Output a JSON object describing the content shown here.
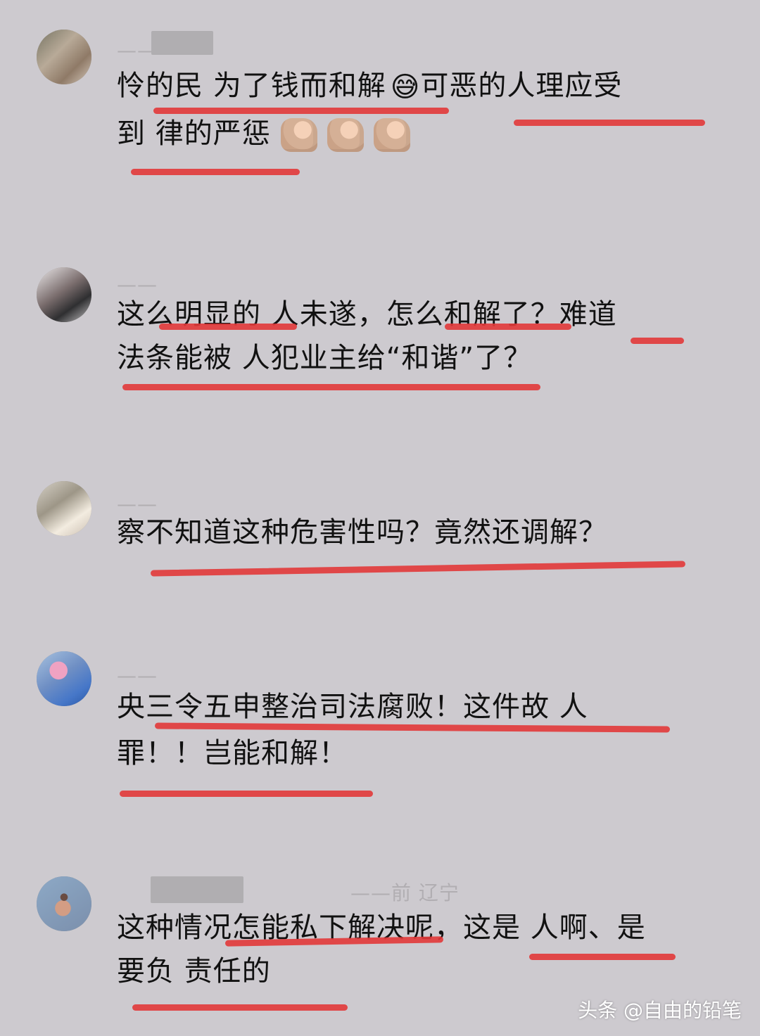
{
  "comments": [
    {
      "id": "c1",
      "meta": "——",
      "lines": [
        "怜的民  为了钱而和解",
        "可恶的人理应受",
        "到 律的严惩"
      ],
      "emoji": "😅",
      "muscles": [
        "💪",
        "💪",
        "💪"
      ]
    },
    {
      "id": "c2",
      "meta": "——",
      "lines": [
        "这么明显的  人未遂，怎么和解了？难道",
        "法条能被  人犯业主给“和谐”了？"
      ]
    },
    {
      "id": "c3",
      "meta": "——",
      "lines": [
        " 察不知道这种危害性吗？竟然还调解？"
      ]
    },
    {
      "id": "c4",
      "meta": "——",
      "lines": [
        "央三令五申整治司法腐败！这件故  人",
        "罪！！岂能和解！"
      ]
    },
    {
      "id": "c5",
      "meta": "——前  辽宁",
      "lines": [
        "这种情况怎能私下解决呢，这是  人啊、是",
        "要负  责任的"
      ]
    }
  ],
  "watermark": "头条 @自由的铅笔",
  "colors": {
    "background": "#cdcacf",
    "highlight": "#e23939",
    "text": "#111111",
    "meta": "#9b989c"
  },
  "icons": {
    "emoji": "sweat-smile-icon",
    "muscle": "muscle-icon"
  }
}
